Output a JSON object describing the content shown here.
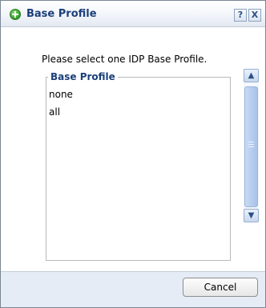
{
  "dialog": {
    "title": "Base Profile",
    "help_label": "?",
    "close_label": "X"
  },
  "main": {
    "prompt": "Please select one IDP Base Profile.",
    "fieldset_legend": "Base Profile",
    "items": [
      {
        "label": "none"
      },
      {
        "label": "all"
      }
    ]
  },
  "scrollbar": {
    "up_label": "▲",
    "down_label": "▼"
  },
  "footer": {
    "cancel_label": "Cancel"
  }
}
